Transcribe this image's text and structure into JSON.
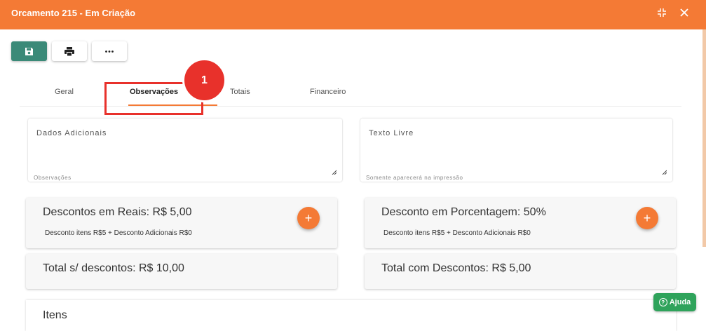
{
  "header": {
    "title": "Orcamento 215 - Em Criação",
    "icons": [
      "collapse-icon",
      "close-icon"
    ]
  },
  "toolbar": {
    "buttons": [
      "save-icon",
      "print-icon",
      "more-icon"
    ]
  },
  "tabs": [
    {
      "label": "Geral",
      "active": false
    },
    {
      "label": "Observações",
      "active": true
    },
    {
      "label": "Totais",
      "active": false
    },
    {
      "label": "Financeiro",
      "active": false
    }
  ],
  "annotation": {
    "step": "1"
  },
  "fields": {
    "dados_adicionais": {
      "label": "Dados Adicionais",
      "hint": "Observações",
      "value": ""
    },
    "texto_livre": {
      "label": "Texto Livre",
      "hint": "Somente aparecerá na impressão",
      "value": ""
    }
  },
  "cards": {
    "desconto_reais": {
      "title": "Descontos em Reais: R$ 5,00",
      "detail": "Desconto itens R$5 + Desconto Adicionais R$0"
    },
    "desconto_porcentagem": {
      "title": "Desconto em Porcentagem: 50%",
      "detail": "Desconto itens R$5 + Desconto Adicionais R$0"
    },
    "total_sem_desconto": {
      "title": "Total s/ descontos: R$ 10,00"
    },
    "total_com_desconto": {
      "title": "Total com Descontos: R$ 5,00"
    }
  },
  "items": {
    "title": "Itens"
  },
  "help": {
    "label": "Ajuda"
  },
  "colors": {
    "accent": "#f47a35",
    "save": "#3b8a78",
    "help": "#2fa35b",
    "highlight": "#e8312b"
  }
}
